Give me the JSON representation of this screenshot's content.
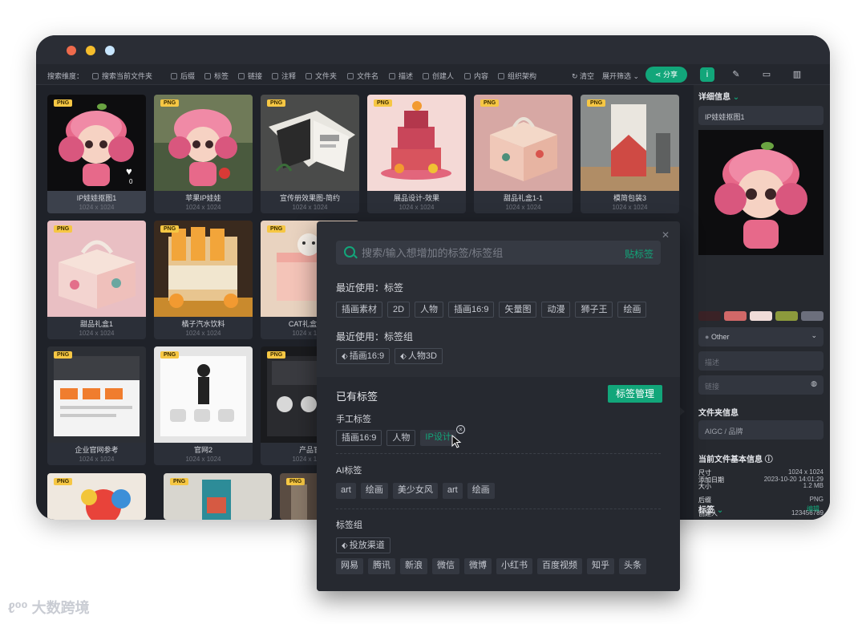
{
  "window": {
    "controls": [
      "close",
      "minimize",
      "maximize"
    ]
  },
  "filterbar": {
    "label": "搜索维度：",
    "options": [
      "搜索当前文件夹",
      "后缀",
      "标签",
      "链接",
      "注释",
      "文件夹",
      "文件名",
      "描述",
      "创建人",
      "内容",
      "组织架构"
    ],
    "clear": "清空",
    "expand": "展开筛选",
    "share": "分享"
  },
  "cards": [
    {
      "name": "IP娃娃抠图1",
      "size": "1024 x 1024",
      "tag": "PNG",
      "likes": "0"
    },
    {
      "name": "苹果IP娃娃",
      "size": "1024 x 1024",
      "tag": "PNG"
    },
    {
      "name": "宣传册效果图-简约",
      "size": "1024 x 1024",
      "tag": "PNG"
    },
    {
      "name": "展品设计-效果",
      "size": "1024 x 1024",
      "tag": "PNG"
    },
    {
      "name": "甜品礼盒1-1",
      "size": "1024 x 1024",
      "tag": "PNG"
    },
    {
      "name": "模简包装3",
      "size": "1024 x 1024",
      "tag": "PNG"
    },
    {
      "name": "甜品礼盒1",
      "size": "1024 x 1024",
      "tag": "PNG"
    },
    {
      "name": "橘子汽水饮料",
      "size": "1024 x 1024",
      "tag": "PNG"
    },
    {
      "name": "CAT礼盒纹包",
      "size": "1024 x 1024",
      "tag": "PNG"
    },
    {
      "name": "企业官网参考",
      "size": "1024 x 1024",
      "tag": "PNG"
    },
    {
      "name": "官网2",
      "size": "1024 x 1024",
      "tag": "PNG"
    },
    {
      "name": "产品官",
      "size": "1024 x 1024",
      "tag": "PNG"
    },
    {
      "name": "",
      "size": "",
      "tag": "PNG"
    },
    {
      "name": "",
      "size": "",
      "tag": "PNG"
    },
    {
      "name": "",
      "size": "",
      "tag": "PNG"
    }
  ],
  "detail": {
    "section_title": "详细信息",
    "name_value": "IP娃娃抠图1",
    "colors": [
      "#3a2226",
      "#d06868",
      "#f0dcd8",
      "#8c9a3c",
      "#6c6f7c"
    ],
    "category": "Other",
    "desc_placeholder": "描述",
    "link_placeholder": "链接",
    "folder_title": "文件夹信息",
    "folder_value": "AIGC / 品牌",
    "basic_title": "当前文件基本信息",
    "rows": [
      {
        "k": "尺寸",
        "v": "1024 x 1024"
      },
      {
        "k": "大小",
        "v": "1.2 MB"
      },
      {
        "k": "后缀",
        "v": "PNG"
      },
      {
        "k": "创建人",
        "v": "123456789"
      },
      {
        "k": "添加日期",
        "v": "2023-10-20 14:01:29"
      }
    ],
    "tags_title": "标签",
    "edit": "编辑"
  },
  "popup": {
    "search_placeholder": "搜索/输入想增加的标签/标签组",
    "paste": "贴标签",
    "recent_tags_title": "最近使用：标签",
    "recent_tags": [
      "插画素材",
      "2D",
      "人物",
      "插画16:9",
      "矢量图",
      "动漫",
      "狮子王",
      "绘画"
    ],
    "recent_groups_title": "最近使用：标签组",
    "recent_groups": [
      "插画16:9",
      "人物3D"
    ],
    "existing_title": "已有标签",
    "manage": "标签管理",
    "manual_title": "手工标签",
    "manual_tags": [
      "插画16:9",
      "人物",
      "IP设计"
    ],
    "ai_title": "AI标签",
    "ai_tags": [
      "art",
      "绘画",
      "美少女风",
      "art",
      "绘画"
    ],
    "group_title": "标签组",
    "group_name": "投放渠道",
    "group_tags": [
      "网易",
      "腾讯",
      "新浪",
      "微信",
      "微博",
      "小红书",
      "百度视频",
      "知乎",
      "头条"
    ]
  },
  "watermark": "大数跨境"
}
